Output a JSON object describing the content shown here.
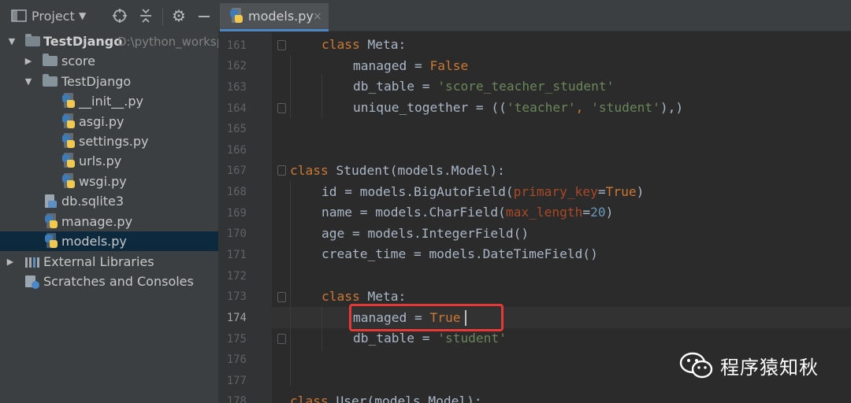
{
  "project_panel": {
    "title": "Project",
    "tree": [
      {
        "label": "TestDjango",
        "path": "D:\\python_worksp",
        "expanded": true
      },
      {
        "label": "score"
      },
      {
        "label": "TestDjango",
        "expanded": true
      },
      {
        "label": "__init__.py"
      },
      {
        "label": "asgi.py"
      },
      {
        "label": "settings.py"
      },
      {
        "label": "urls.py"
      },
      {
        "label": "wsgi.py"
      },
      {
        "label": "db.sqlite3"
      },
      {
        "label": "manage.py"
      },
      {
        "label": "models.py",
        "selected": true
      },
      {
        "label": "External Libraries"
      },
      {
        "label": "Scratches and Consoles"
      }
    ]
  },
  "editor": {
    "tab": {
      "label": "models.py",
      "close": "×"
    },
    "current_line": "174",
    "lines": [
      {
        "n": "161"
      },
      {
        "n": "162"
      },
      {
        "n": "163"
      },
      {
        "n": "164"
      },
      {
        "n": "165"
      },
      {
        "n": "166"
      },
      {
        "n": "167"
      },
      {
        "n": "168"
      },
      {
        "n": "169"
      },
      {
        "n": "170"
      },
      {
        "n": "171"
      },
      {
        "n": "172"
      },
      {
        "n": "173"
      },
      {
        "n": "174"
      },
      {
        "n": "175"
      },
      {
        "n": "176"
      },
      {
        "n": "177"
      },
      {
        "n": "178"
      }
    ],
    "code": {
      "l161": {
        "kw": "class",
        "rest": " Meta:"
      },
      "l162": {
        "a": "managed = ",
        "b": "False"
      },
      "l163": {
        "a": "db_table = ",
        "b": "'score_teacher_student'"
      },
      "l164": {
        "a": "unique_together = ((",
        "b": "'teacher'",
        "c": ", ",
        "d": "'student'",
        "e": "),)"
      },
      "l167": {
        "kw": "class",
        "rest": " Student(models.Model):"
      },
      "l168": {
        "a": "id = models.BigAutoField(",
        "p": "primary_key",
        "eq": "=",
        "v": "True",
        "e": ")"
      },
      "l169": {
        "a": "name = models.CharField(",
        "p": "max_length",
        "eq": "=",
        "v": "20",
        "e": ")"
      },
      "l170": {
        "a": "age = models.IntegerField()"
      },
      "l171": {
        "a": "create_time = models.DateTimeField()"
      },
      "l173": {
        "kw": "class",
        "rest": " Meta:"
      },
      "l174": {
        "a": "managed = ",
        "b": "True"
      },
      "l175": {
        "a": "db_table = ",
        "b": "'student'"
      },
      "l178": {
        "kw": "class",
        "rest": " User(models.Model):"
      }
    }
  },
  "watermark": {
    "text": "程序猿知秋",
    "logo": "wechat-logo"
  },
  "colors": {
    "keyword": "#cc7832",
    "string": "#6a8759",
    "number": "#6897bb",
    "param": "#aa4926",
    "highlight": "#e53935"
  }
}
